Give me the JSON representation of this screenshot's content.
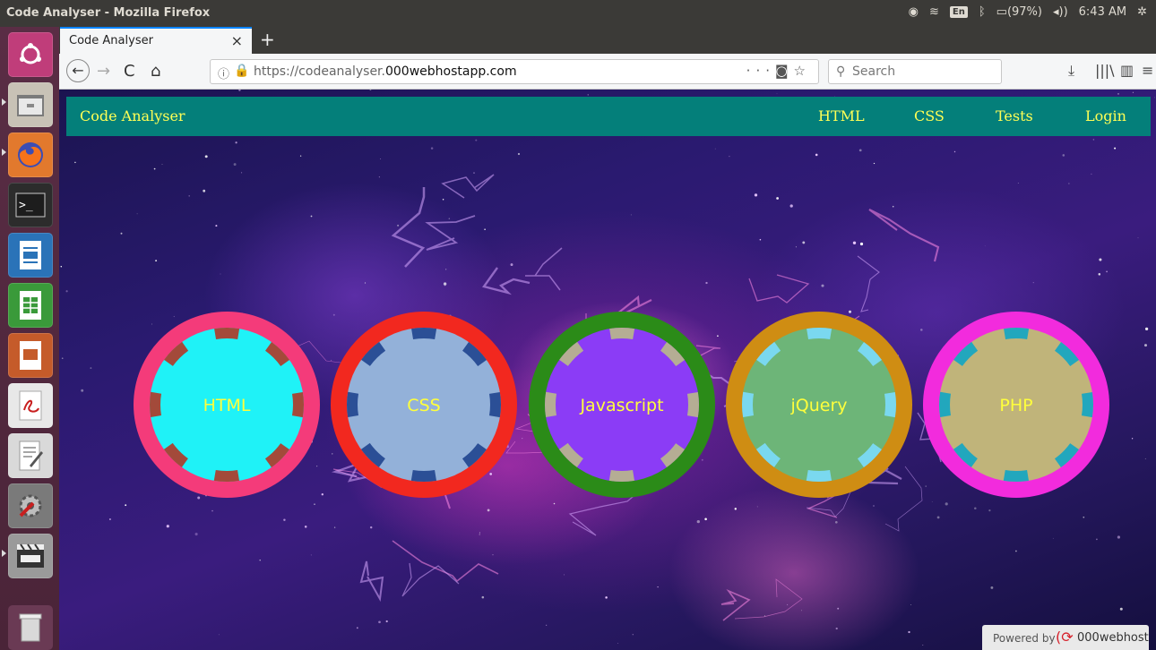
{
  "system": {
    "window_title": "Code Analyser - Mozilla Firefox",
    "keyboard": "En",
    "battery": "(97%)",
    "clock": "6:43 AM"
  },
  "launcher": {
    "items": [
      "ubuntu-dash",
      "files",
      "firefox",
      "terminal",
      "writer",
      "calc",
      "impress",
      "document-viewer",
      "text-editor",
      "system-settings",
      "video-editor",
      "trash"
    ]
  },
  "browser": {
    "tab_title": "Code Analyser",
    "url_prefix": "https://codeanalyser.",
    "url_domain": "000webhostapp.com",
    "search_placeholder": "Search"
  },
  "site": {
    "brand": "Code Analyser",
    "nav": [
      {
        "label": "HTML"
      },
      {
        "label": "CSS"
      },
      {
        "label": "Tests"
      },
      {
        "label": "Login"
      }
    ],
    "chips": [
      {
        "label": "HTML",
        "ring": "#f43b7a",
        "face": "#1ff2f7",
        "notch": "#a34a3a"
      },
      {
        "label": "CSS",
        "ring": "#f2281f",
        "face": "#93b1d9",
        "notch": "#2b4f96"
      },
      {
        "label": "Javascript",
        "ring": "#2b8b18",
        "face": "#8b3cf6",
        "notch": "#b5ad94"
      },
      {
        "label": "jQuery",
        "ring": "#cf8d13",
        "face": "#6db578",
        "notch": "#7ad8ef"
      },
      {
        "label": "PHP",
        "ring": "#f22bdd",
        "face": "#c0b47a",
        "notch": "#22a7bd"
      }
    ],
    "chip_text_color": "#ffff3c"
  },
  "footer": {
    "powered_by": "Powered by",
    "host_brand": "000webhost"
  }
}
